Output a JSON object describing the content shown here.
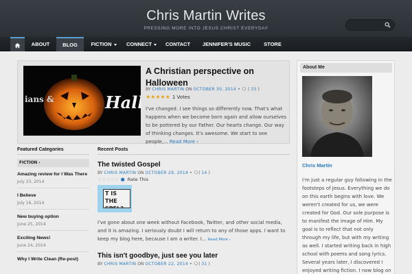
{
  "header": {
    "site_title": "Chris Martin Writes",
    "tagline": "PRESSING MORE INTO JESUS CHRIST EVERYDAY"
  },
  "nav": {
    "home_icon": "home-icon",
    "items": [
      {
        "label": "ABOUT"
      },
      {
        "label": "BLOG"
      },
      {
        "label": "FICTION"
      },
      {
        "label": "CONNECT"
      },
      {
        "label": "CONTACT"
      },
      {
        "label": "JENNIFER'S MUSIC"
      },
      {
        "label": "STORE"
      }
    ],
    "active": "BLOG"
  },
  "featured": {
    "title": "A Christian perspective on Halloween",
    "by": "BY",
    "author": "CHRIS MARTIN",
    "on": "ON",
    "date": "OCTOBER 30, 2014",
    "comment_count": "33",
    "votes": "1 Votes",
    "rating": 5,
    "excerpt": "I've changed. I see things so differently now. That's what happens when we become born again and allow ourselves to be pottered by our Father. Our hearts change. Our way of thinking changes. It's awesome. We start to see people,...",
    "more": "Read More ›",
    "image_text_left": "ians &",
    "image_text_right": "Hallow"
  },
  "categories": {
    "heading": "Featured Categories",
    "pill": "FICTION ›",
    "items": [
      {
        "title": "Amazing review for I Was There",
        "date": "July 23, 2014"
      },
      {
        "title": "I Believe",
        "date": "July 16, 2014"
      },
      {
        "title": "New buying option",
        "date": "June 25, 2014"
      },
      {
        "title": "Exciting News!",
        "date": "June 24, 2014"
      },
      {
        "title": "Why I Write Clean (Re-post)",
        "date": ""
      }
    ]
  },
  "recent": {
    "heading": "Recent Posts",
    "posts": [
      {
        "title": "The twisted Gospel",
        "author": "CHRIS MARTIN",
        "date": "OCTOBER 29, 2014",
        "comment_count": "14",
        "rate_label": "Rate This",
        "thumb_text": "T IS THE SPEL?",
        "excerpt": "I've gone about one week without Facebook, Twitter, and other social media, and it is amazing. I seriously doubt I will return to any of those apps. I want to keep my blog here, because I am a writer. I...",
        "more": "Read More ›"
      },
      {
        "title": "This isn't goodbye, just see you later",
        "author": "CHRIS MARTIN",
        "date": "OCTOBER 22, 2014",
        "comment_count": "31"
      }
    ]
  },
  "sidebar": {
    "heading": "About Me",
    "name": "Chris Martin",
    "text": "I'm just a regular guy following in the footsteps of Jesus. Everything we do on this earth begins with love. We weren't created for us, we were created for God. Our sole purpose is to manifest the image of Him. My goal is to reflect that not only through my life, but with my writing as well. I started writing back in high school with poems and song lyrics. Several years later, I discovered I enjoyed writing fiction. I now blog on a"
  },
  "colors": {
    "accent": "#2a7abf",
    "header_bg": "#2f3438",
    "star": "#e8a317"
  }
}
